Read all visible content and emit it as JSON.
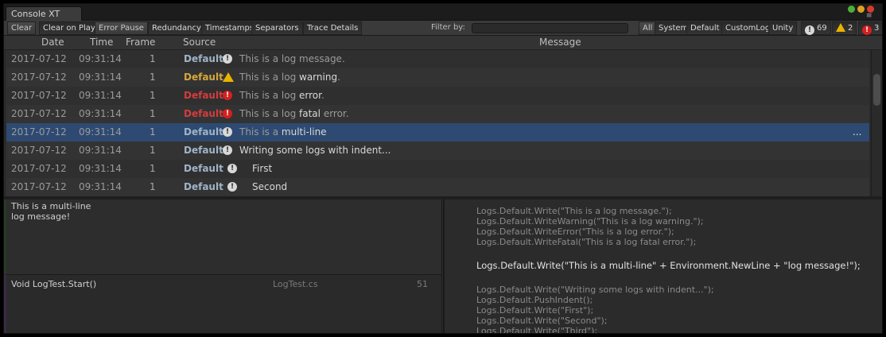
{
  "window": {
    "tab_title": "Console XT"
  },
  "toolbar": {
    "clear": "Clear",
    "clear_on_play": "Clear on Play",
    "error_pause": "Error Pause",
    "redundancy": "Redundancy",
    "timestamps": "Timestamps",
    "separators": "Separators",
    "trace_details": "Trace Details",
    "filter_label": "Filter by:",
    "filter_value": "",
    "channels": [
      "All",
      "System",
      "Default",
      "CustomLog",
      "Unity"
    ],
    "counts": {
      "info": "69",
      "warning": "2",
      "error": "3"
    }
  },
  "columns": {
    "date": "Date",
    "time": "Time",
    "frame": "Frame",
    "source": "Source",
    "message": "Message"
  },
  "rows": [
    {
      "date": "2017-07-12",
      "time": "09:31:14",
      "frame": "1",
      "source": "Default",
      "type": "info",
      "msg_pre": "This is a log message.",
      "msg_em": "",
      "msg_post": ""
    },
    {
      "date": "2017-07-12",
      "time": "09:31:14",
      "frame": "1",
      "source": "Default",
      "type": "warning",
      "msg_pre": "This is a log ",
      "msg_em": "warning",
      "msg_post": "."
    },
    {
      "date": "2017-07-12",
      "time": "09:31:14",
      "frame": "1",
      "source": "Default",
      "type": "error",
      "msg_pre": "This is a log ",
      "msg_em": "error",
      "msg_post": "."
    },
    {
      "date": "2017-07-12",
      "time": "09:31:14",
      "frame": "1",
      "source": "Default",
      "type": "fatal",
      "msg_pre": "This is a log ",
      "msg_em": "fatal",
      "msg_post": " error."
    },
    {
      "date": "2017-07-12",
      "time": "09:31:14",
      "frame": "1",
      "source": "Default",
      "type": "info",
      "msg_pre": "This is a ",
      "msg_em": "multi-line",
      "msg_post": "",
      "more": "..."
    },
    {
      "date": "2017-07-12",
      "time": "09:31:14",
      "frame": "1",
      "source": "Default",
      "type": "info",
      "msg_pre": "",
      "msg_em": "Writing some logs with indent...",
      "msg_post": ""
    },
    {
      "date": "2017-07-12",
      "time": "09:31:14",
      "frame": "1",
      "source": "Default",
      "type": "info",
      "msg_pre": "",
      "msg_em": "First",
      "msg_post": ""
    },
    {
      "date": "2017-07-12",
      "time": "09:31:14",
      "frame": "1",
      "source": "Default",
      "type": "info",
      "msg_pre": "",
      "msg_em": "Second",
      "msg_post": ""
    }
  ],
  "detail": {
    "line1": "This is a multi-line",
    "line2": "log message!"
  },
  "stack": {
    "method": "Void LogTest.Start()",
    "file": "LogTest.cs",
    "line": "51"
  },
  "source_code": {
    "lines": [
      "Logs.Default.Write(\"This is a log message.\");",
      "Logs.Default.WriteWarning(\"This is a log warning.\");",
      "Logs.Default.WriteError(\"This is a log error.\");",
      "Logs.Default.WriteFatal(\"This is a log fatal error.\");",
      "Logs.Default.Write(\"This is a multi-line\" + Environment.NewLine + \"log message!\");",
      "Logs.Default.Write(\"Writing some logs with indent...\");",
      "Logs.Default.PushIndent();",
      "Logs.Default.Write(\"First\");",
      "Logs.Default.Write(\"Second\");",
      "Logs.Default.Write(\"Third\");"
    ]
  },
  "colors": {
    "source_info": "#9fb4c8",
    "source_warning": "#d6a83a",
    "source_error": "#d43c3c",
    "selected_row": "#2e4a72"
  }
}
